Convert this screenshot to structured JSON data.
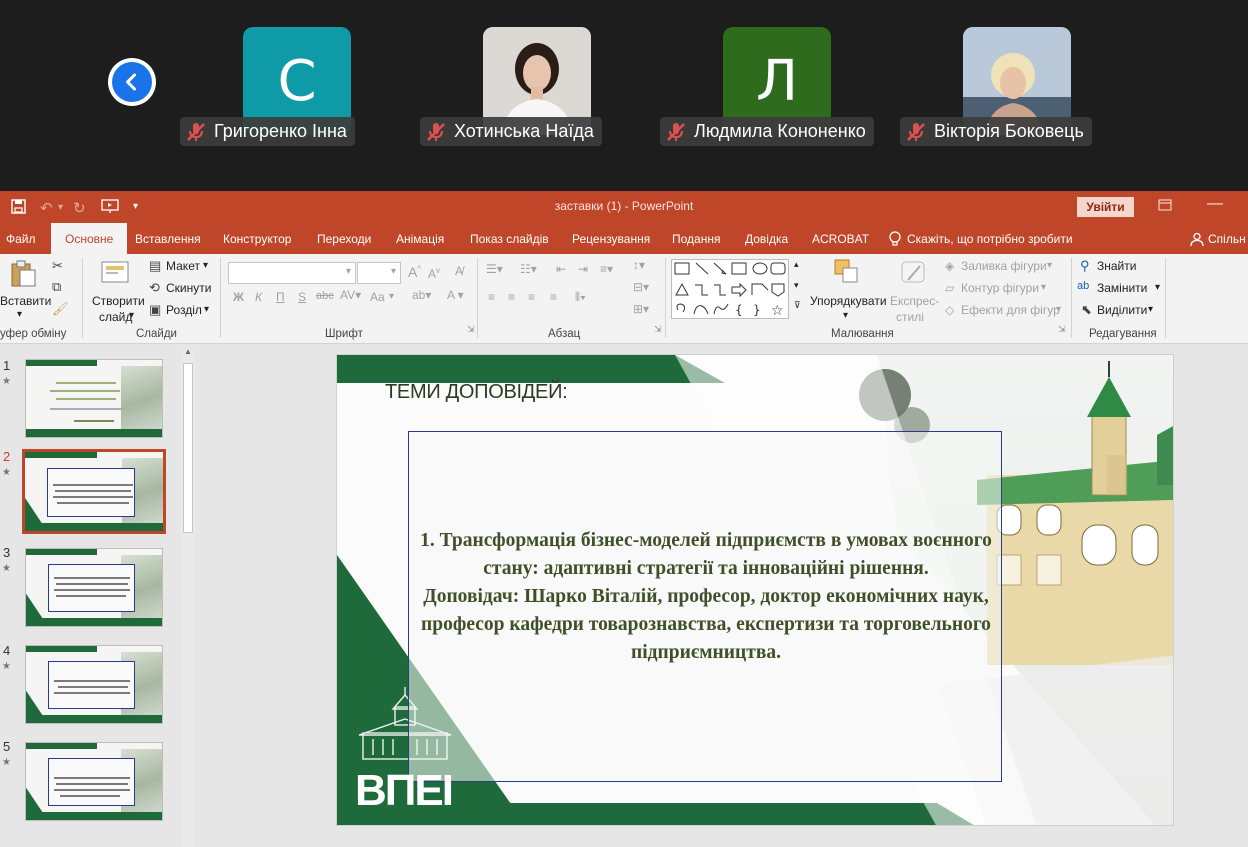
{
  "call": {
    "back_icon": "chevron-left-icon",
    "participants": [
      {
        "name": "Григоренко Інна",
        "avatar_letter": "С",
        "avatar_color": "#0e9aa7",
        "muted": true
      },
      {
        "name": "Хотинська Наїда",
        "avatar_letter": "",
        "avatar_color": "#d9d5d2",
        "muted": true
      },
      {
        "name": "Людмила Кононенко",
        "avatar_letter": "Л",
        "avatar_color": "#2e6b1c",
        "muted": true
      },
      {
        "name": "Вікторія Боковець",
        "avatar_letter": "",
        "avatar_color": "#9fb2c6",
        "muted": true
      }
    ]
  },
  "titlebar": {
    "title": "заставки (1)  -  PowerPoint",
    "signin_label": "Увійти",
    "accent_color": "#c0462a"
  },
  "tabs": [
    "Файл",
    "Основне",
    "Вставлення",
    "Конструктор",
    "Переходи",
    "Анімація",
    "Показ слайдів",
    "Рецензування",
    "Подання",
    "Довідка",
    "ACROBAT"
  ],
  "active_tab": "Основне",
  "tell_me": "Скажіть, що потрібно зробити",
  "share_label": "Спільн",
  "ribbon": {
    "clipboard": {
      "paste_label": "Вставити",
      "group": "уфер обміну"
    },
    "slides": {
      "new_slide_label1": "Створити",
      "new_slide_label2": "слайд",
      "layout": "Макет",
      "reset": "Скинути",
      "section": "Розділ",
      "group": "Слайди"
    },
    "font": {
      "bold": "Ж",
      "italic": "К",
      "underline": "П",
      "strike": "S",
      "spacing": "abc",
      "case": "Aa",
      "group": "Шрифт"
    },
    "paragraph": {
      "group": "Абзац"
    },
    "drawing": {
      "arrange": "Упорядкувати",
      "quick_styles1": "Експрес-",
      "quick_styles2": "стилі",
      "fill": "Заливка фігури",
      "outline": "Контур фігури",
      "effects": "Ефекти для фігур",
      "group": "Малювання"
    },
    "editing": {
      "find": "Знайти",
      "replace": "Замінити",
      "select": "Виділити",
      "group": "Редагування"
    }
  },
  "thumbnails": [
    {
      "num": "1",
      "selected": false
    },
    {
      "num": "2",
      "selected": true
    },
    {
      "num": "3",
      "selected": false
    },
    {
      "num": "4",
      "selected": false
    },
    {
      "num": "5",
      "selected": false
    }
  ],
  "slide": {
    "title": "ТЕМИ ДОПОВІДЕЙ:",
    "body": "1. Трансформація бізнес-моделей підприємств в умовах воєнного стану: адаптивні стратегії та інноваційні рішення.\nДоповідач: Шарко Віталій, професор, доктор економічних наук, професор кафедри товарознавства, експертизи та торговельного підприємництва.",
    "logo": "ВПЕІ",
    "green_color": "#1f6a3b"
  }
}
